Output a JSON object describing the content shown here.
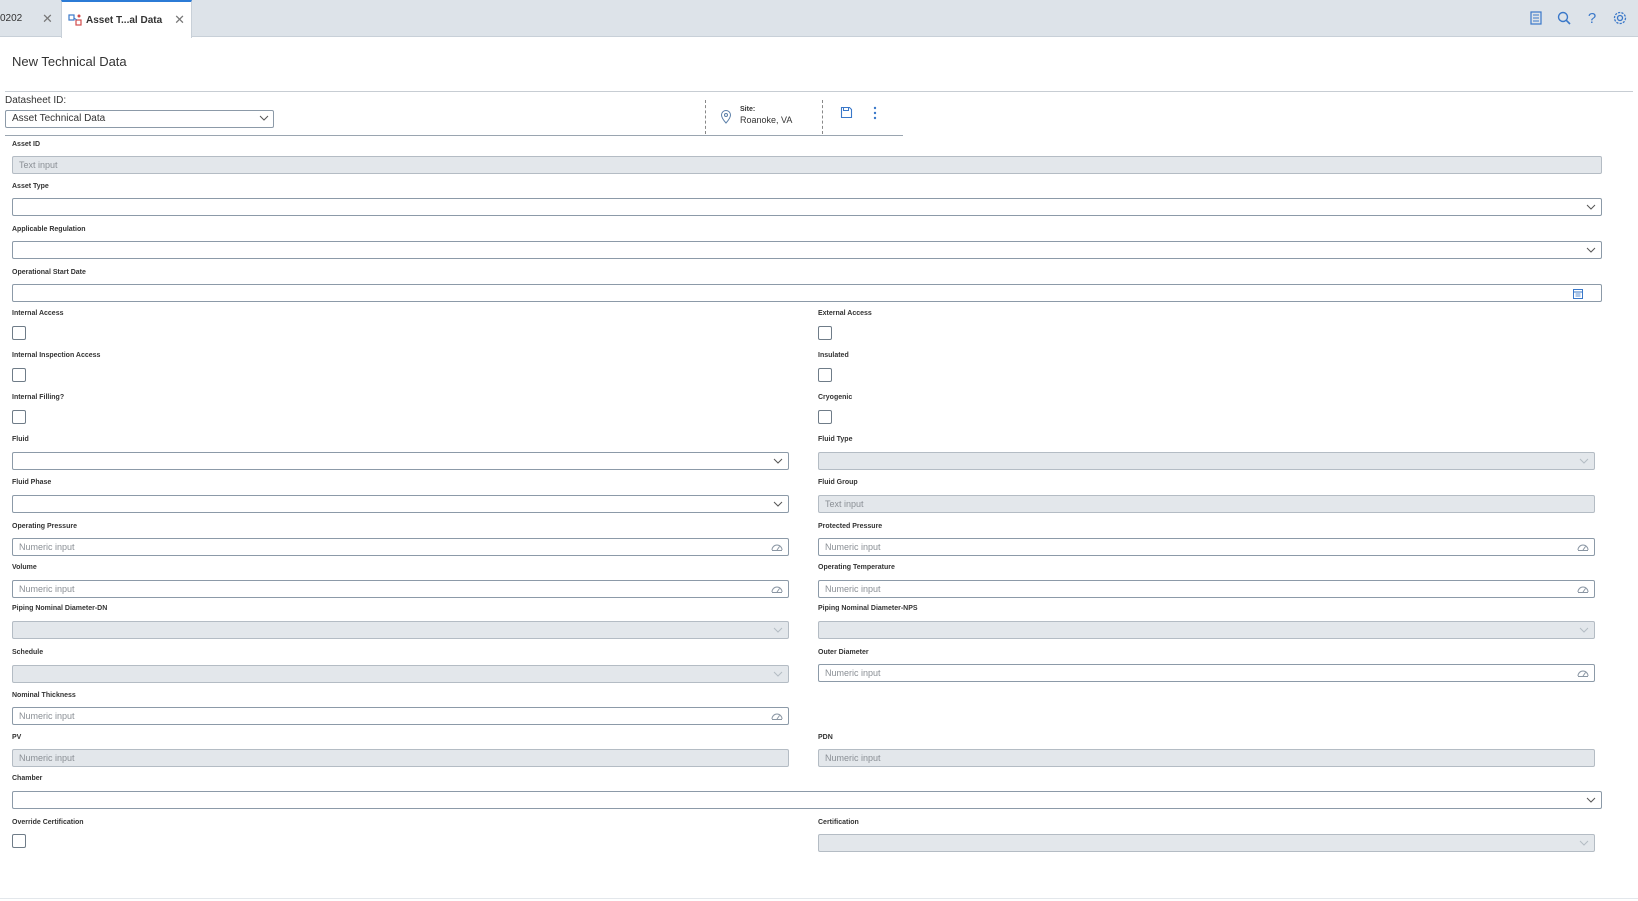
{
  "tabs": [
    {
      "label": "0202",
      "active": false
    },
    {
      "label": "Asset T...al Data",
      "active": true
    }
  ],
  "top_icons": [
    "report-icon",
    "search-icon",
    "help-icon",
    "settings-icon"
  ],
  "page_title": "New Technical Data",
  "datasheet": {
    "label": "Datasheet ID:",
    "value": "Asset Technical Data"
  },
  "site": {
    "label": "Site:",
    "value": "Roanoke, VA"
  },
  "accent_color": "#3a78c9",
  "fields": {
    "asset_id": {
      "label": "Asset ID",
      "placeholder": "Text input"
    },
    "asset_type": {
      "label": "Asset Type",
      "value": ""
    },
    "applicable_regulation": {
      "label": "Applicable Regulation",
      "value": ""
    },
    "operational_start_date": {
      "label": "Operational Start Date",
      "value": ""
    },
    "internal_access": {
      "label": "Internal Access",
      "checked": false
    },
    "external_access": {
      "label": "External Access",
      "checked": false
    },
    "internal_inspection_access": {
      "label": "Internal Inspection Access",
      "checked": false
    },
    "insulated": {
      "label": "Insulated",
      "checked": false
    },
    "internal_filling": {
      "label": "Internal Filling?",
      "checked": false
    },
    "cryogenic": {
      "label": "Cryogenic",
      "checked": false
    },
    "fluid": {
      "label": "Fluid",
      "value": ""
    },
    "fluid_type": {
      "label": "Fluid Type",
      "value": ""
    },
    "fluid_phase": {
      "label": "Fluid Phase",
      "value": ""
    },
    "fluid_group": {
      "label": "Fluid Group",
      "placeholder": "Text input"
    },
    "operating_pressure": {
      "label": "Operating Pressure",
      "placeholder": "Numeric input"
    },
    "protected_pressure": {
      "label": "Protected Pressure",
      "placeholder": "Numeric input"
    },
    "volume": {
      "label": "Volume",
      "placeholder": "Numeric input"
    },
    "operating_temperature": {
      "label": "Operating Temperature",
      "placeholder": "Numeric input"
    },
    "piping_dn": {
      "label": "Piping Nominal Diameter-DN",
      "value": ""
    },
    "piping_nps": {
      "label": "Piping Nominal Diameter-NPS",
      "value": ""
    },
    "schedule": {
      "label": "Schedule",
      "value": ""
    },
    "outer_diameter": {
      "label": "Outer Diameter",
      "placeholder": "Numeric input"
    },
    "nominal_thickness": {
      "label": "Nominal Thickness",
      "placeholder": "Numeric input"
    },
    "pv": {
      "label": "PV",
      "placeholder": "Numeric input"
    },
    "pdn": {
      "label": "PDN",
      "placeholder": "Numeric input"
    },
    "chamber": {
      "label": "Chamber",
      "value": ""
    },
    "override_certification": {
      "label": "Override Certification",
      "checked": false
    },
    "certification": {
      "label": "Certification",
      "value": ""
    }
  }
}
